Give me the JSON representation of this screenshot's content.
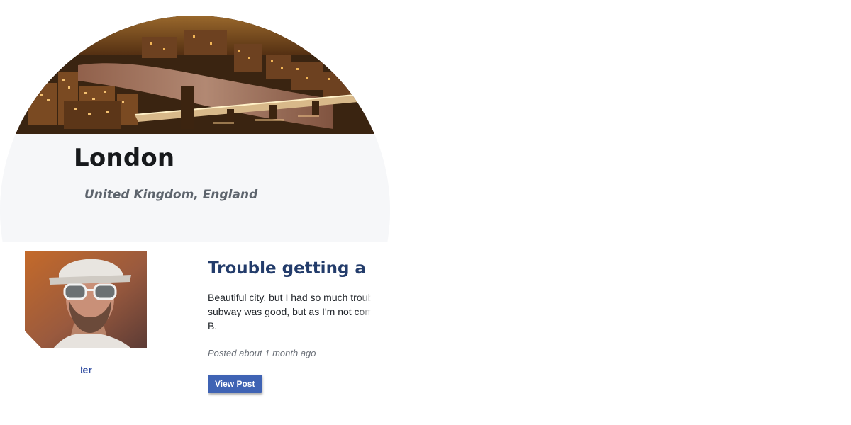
{
  "city": {
    "name": "London",
    "location": "United Kingdom, England",
    "hero_image": "london-skyline-night"
  },
  "post": {
    "author_avatar": "man-with-sunglasses-and-cap",
    "author_name_visible": "lter",
    "title": "Trouble getting a taxi",
    "excerpt_lines": [
      "Beautiful city, but I had so much troub",
      "subway was good, but as I'm not com",
      "B."
    ],
    "meta": "Posted about 1 month ago",
    "button_label": "View Post"
  },
  "colors": {
    "title_blue": "#233c6b",
    "button_blue": "#3f63b4",
    "author_blue": "#2d4aa0",
    "info_panel_bg": "#f6f7f9"
  }
}
